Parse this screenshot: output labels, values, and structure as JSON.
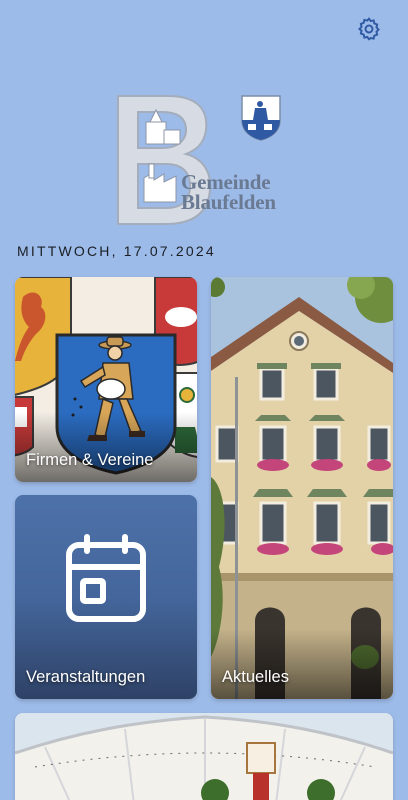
{
  "header": {
    "settings_icon": "gear-icon"
  },
  "logo": {
    "line1": "Gemeinde",
    "line2": "Blaufelden"
  },
  "date": "MITTWOCH, 17.07.2024",
  "tiles": [
    {
      "label": "Firmen & Vereine",
      "icon": "coat-of-arms-image"
    },
    {
      "label": "Veranstaltungen",
      "icon": "calendar-icon"
    },
    {
      "label": "Aktuelles",
      "icon": "town-hall-image"
    }
  ],
  "colors": {
    "background": "#9dbbe9",
    "accent": "#3c64a8",
    "tile_blue": "#44669c"
  }
}
